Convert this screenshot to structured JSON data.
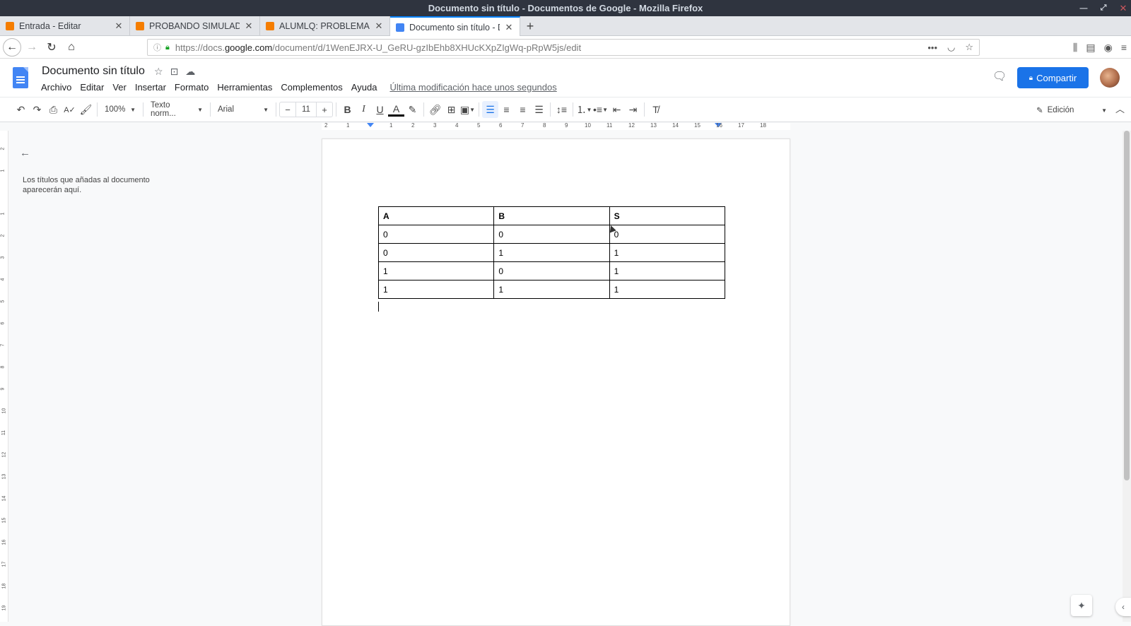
{
  "window": {
    "title": "Documento sin título - Documentos de Google - Mozilla Firefox"
  },
  "tabs": [
    {
      "label": "Entrada - Editar",
      "favicon": "blogger-icon"
    },
    {
      "label": "PROBANDO SIMULADO",
      "favicon": "blogger-icon"
    },
    {
      "label": "ALUMLQ: PROBLEMAS",
      "favicon": "blogger-icon"
    },
    {
      "label": "Documento sin título - D",
      "favicon": "google-docs-icon",
      "active": true
    }
  ],
  "address": {
    "prefix": "https://docs.",
    "host": "google.com",
    "path": "/document/d/1WenEJRX-U_GeRU-gzIbEhb8XHUcKXpZIgWq-pRpW5js/edit"
  },
  "docs": {
    "title": "Documento sin título",
    "menu": [
      "Archivo",
      "Editar",
      "Ver",
      "Insertar",
      "Formato",
      "Herramientas",
      "Complementos",
      "Ayuda"
    ],
    "last_modified": "Última modificación hace unos segundos",
    "share_label": "Compartir"
  },
  "toolbar": {
    "zoom": "100%",
    "style": "Texto norm...",
    "font": "Arial",
    "font_size": "11",
    "mode": "Edición"
  },
  "ruler": {
    "ticks": [
      "2",
      "1",
      "1",
      "2",
      "3",
      "4",
      "5",
      "6",
      "7",
      "8",
      "9",
      "10",
      "11",
      "12",
      "13",
      "14",
      "15",
      "16",
      "17",
      "18"
    ]
  },
  "vruler": {
    "ticks": [
      "2",
      "1",
      "1",
      "2",
      "3",
      "4",
      "5",
      "6",
      "7",
      "8",
      "9",
      "10",
      "11",
      "12",
      "13",
      "14",
      "15",
      "16",
      "17",
      "18",
      "19"
    ]
  },
  "outline": {
    "hint": "Los títulos que añadas al documento aparecerán aquí."
  },
  "table": {
    "headers": [
      "A",
      "B",
      "S"
    ],
    "rows": [
      [
        "0",
        "0",
        "0"
      ],
      [
        "0",
        "1",
        "1"
      ],
      [
        "1",
        "0",
        "1"
      ],
      [
        "1",
        "1",
        "1"
      ]
    ]
  },
  "colors": {
    "accent": "#1a73e8",
    "title_bar": "#2f343f",
    "docs_blue": "#4285f4",
    "blogger_orange": "#f57d00"
  }
}
